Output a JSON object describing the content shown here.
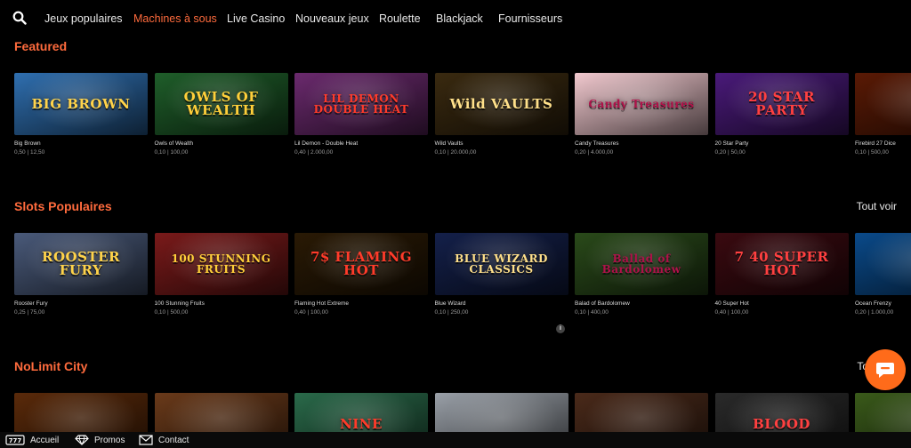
{
  "nav": {
    "items": [
      {
        "label": "Jeux populaires"
      },
      {
        "label": "Machines à sous"
      },
      {
        "label": "Live Casino"
      },
      {
        "label": "Nouveaux jeux"
      },
      {
        "label": "Roulette"
      },
      {
        "label": "Blackjack"
      },
      {
        "label": "Fournisseurs"
      }
    ],
    "active": "Machines à sous",
    "accent_color": "#ff6b3d"
  },
  "sections": [
    {
      "title": "Featured",
      "see_all": "",
      "games": [
        {
          "name": "Big Brown",
          "bet": "0,50 | 12,50",
          "art": "BIG BROWN",
          "bg": "#2f6fb0"
        },
        {
          "name": "Owls of Wealth",
          "bet": "0,10 | 100,00",
          "art": "OWLS OF WEALTH",
          "bg": "#1f5e2a"
        },
        {
          "name": "Lil Demon - Double Heat",
          "bet": "0,40 | 2.000,00",
          "art": "LIL DEMON DOUBLE HEAT",
          "bg": "#6b2a6e"
        },
        {
          "name": "Wild Vaults",
          "bet": "0,10 | 20.000,00",
          "art": "Wild VAULTS",
          "bg": "#3a2a10"
        },
        {
          "name": "Candy Treasures",
          "bet": "0,20 | 4.000,00",
          "art": "Candy Treasures",
          "bg": "#f2c9cf"
        },
        {
          "name": "20 Star Party",
          "bet": "0,20 | 50,00",
          "art": "20 STAR PARTY",
          "bg": "#4a1a7a"
        },
        {
          "name": "Firebird 27 Dice",
          "bet": "0,10 | 500,00",
          "art": "",
          "bg": "#5a1a05"
        }
      ]
    },
    {
      "title": "Slots Populaires",
      "see_all": "Tout voir",
      "games": [
        {
          "name": "Rooster Fury",
          "bet": "0,25 | 75,00",
          "art": "ROOSTER FURY",
          "bg": "#4a5a7a"
        },
        {
          "name": "100 Stunning Fruits",
          "bet": "0,10 | 500,00",
          "art": "100 STUNNING FRUITS",
          "bg": "#7a1a1a"
        },
        {
          "name": "Flaming Hot Extreme",
          "bet": "0,40 | 100,00",
          "art": "7$ FLAMING HOT",
          "bg": "#2a1a05"
        },
        {
          "name": "Blue Wizard",
          "bet": "0,10 | 250,00",
          "art": "BLUE WIZARD CLASSICS",
          "bg": "#14204a"
        },
        {
          "name": "Balad of Bardolomew",
          "bet": "0,10 | 400,00",
          "art": "Ballad of Bardolomew",
          "bg": "#2a4a1a"
        },
        {
          "name": "40 Super Hot",
          "bet": "0,40 | 100,00",
          "art": "7 40 SUPER HOT",
          "bg": "#3a0a10"
        },
        {
          "name": "Ocean Frenzy",
          "bet": "0,20 | 1.000,00",
          "art": "",
          "bg": "#0a4a8a"
        }
      ]
    },
    {
      "title": "NoLimit City",
      "see_all": "To",
      "games": [
        {
          "art": "",
          "bg": "#5a2a0a"
        },
        {
          "art": "",
          "bg": "#6a3a1a"
        },
        {
          "art": "NINE",
          "bg": "#2a6a4a"
        },
        {
          "art": "",
          "bg": "#9aa0a8"
        },
        {
          "art": "",
          "bg": "#4a2a1a"
        },
        {
          "art": "BLOOD",
          "bg": "#2a2a2a"
        },
        {
          "art": "",
          "bg": "#3a5a1a"
        }
      ]
    }
  ],
  "bottom_bar": {
    "items": [
      {
        "label": "Accueil",
        "icon": "home-icon"
      },
      {
        "label": "Promos",
        "icon": "diamond-icon"
      },
      {
        "label": "Contact",
        "icon": "mail-icon"
      }
    ]
  },
  "chat": {
    "icon": "chat-icon",
    "color": "#ff6b1a"
  }
}
